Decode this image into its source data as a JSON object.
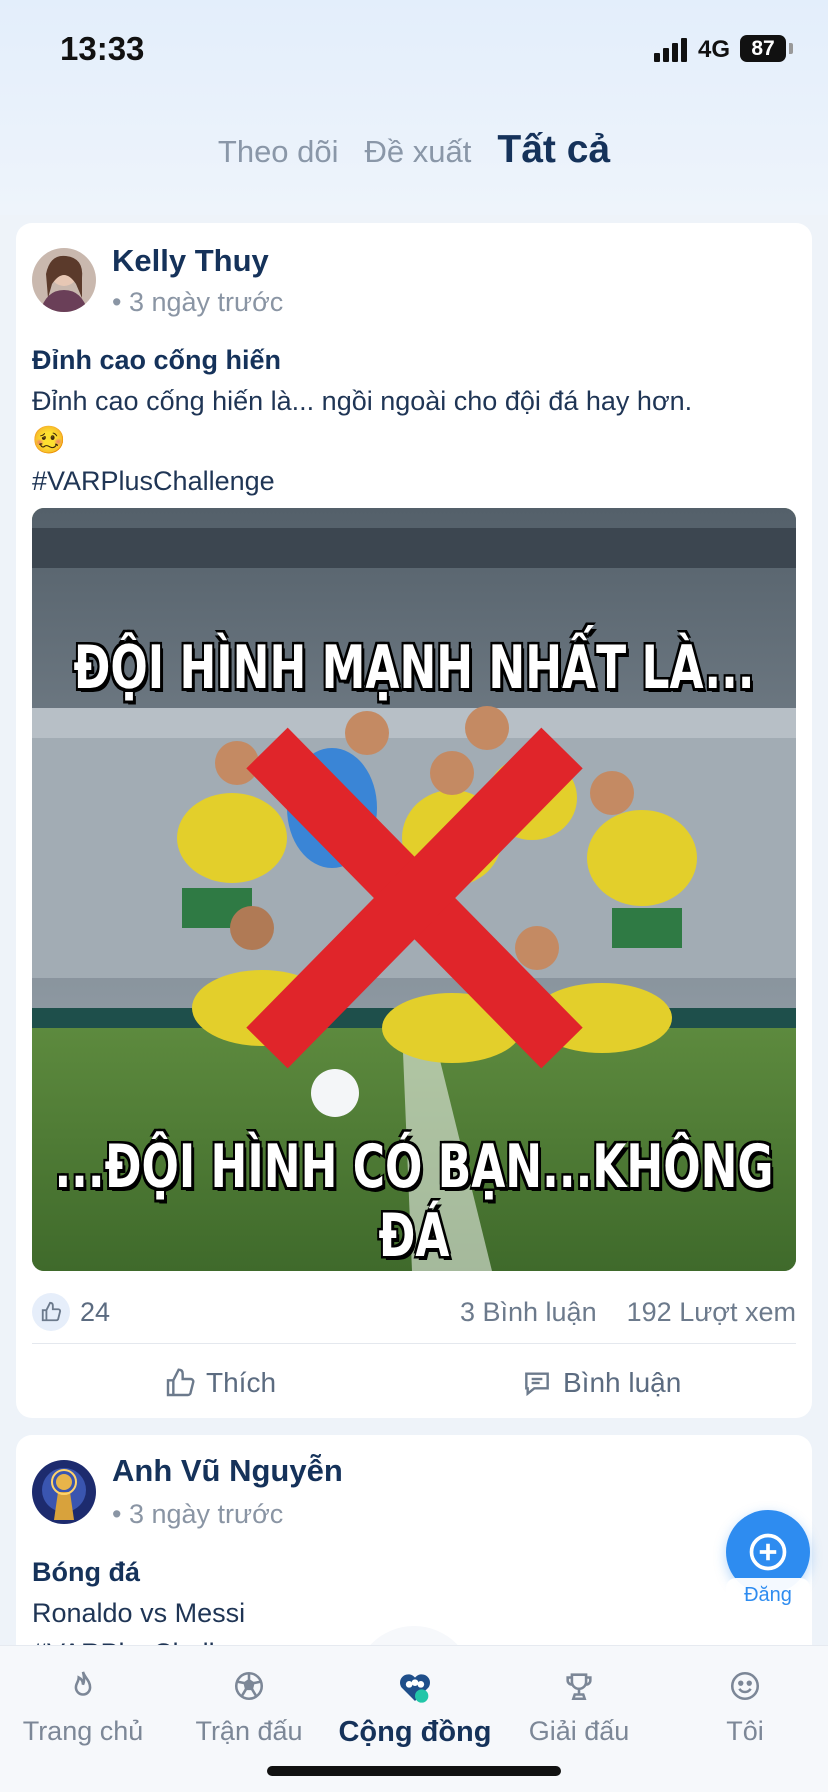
{
  "status_bar": {
    "time": "13:33",
    "network": "4G",
    "battery": "87"
  },
  "feed_tabs": [
    {
      "label": "Theo dõi",
      "active": false
    },
    {
      "label": "Đề xuất",
      "active": false
    },
    {
      "label": "Tất cả",
      "active": true
    }
  ],
  "posts": [
    {
      "author": "Kelly Thuy",
      "time_ago": "• 3 ngày trước",
      "title": "Đỉnh cao cống hiến",
      "body": "Đỉnh cao cống hiến là... ngồi ngoài cho đội đá hay hơn.",
      "emoji": "🥴",
      "hashtag": "#VARPlusChallenge",
      "image": {
        "caption_top": "ĐỘI HÌNH MẠNH NHẤT LÀ...",
        "caption_bottom": "...ĐỘI HÌNH CÓ BẠN...KHÔNG ĐÁ"
      },
      "likes": "24",
      "comments": "3 Bình luận",
      "views": "192 Lượt xem",
      "actions": {
        "like": "Thích",
        "comment": "Bình luận"
      }
    },
    {
      "author": "Anh Vũ Nguyễn",
      "time_ago": "• 3 ngày trước",
      "title": "Bóng đá",
      "body": "Ronaldo vs Messi",
      "hashtag": "#VARPlusChallenge"
    }
  ],
  "fab": {
    "label": "Đăng"
  },
  "bottom_nav": [
    {
      "label": "Trang chủ",
      "icon": "flame-icon",
      "active": false
    },
    {
      "label": "Trận đấu",
      "icon": "soccer-ball-icon",
      "active": false
    },
    {
      "label": "Cộng đồng",
      "icon": "community-icon",
      "active": true
    },
    {
      "label": "Giải đấu",
      "icon": "trophy-icon",
      "active": false
    },
    {
      "label": "Tôi",
      "icon": "smiley-icon",
      "active": false
    }
  ],
  "colors": {
    "accent": "#2e8cf0",
    "heading": "#15325a",
    "muted": "#8a95a4"
  }
}
